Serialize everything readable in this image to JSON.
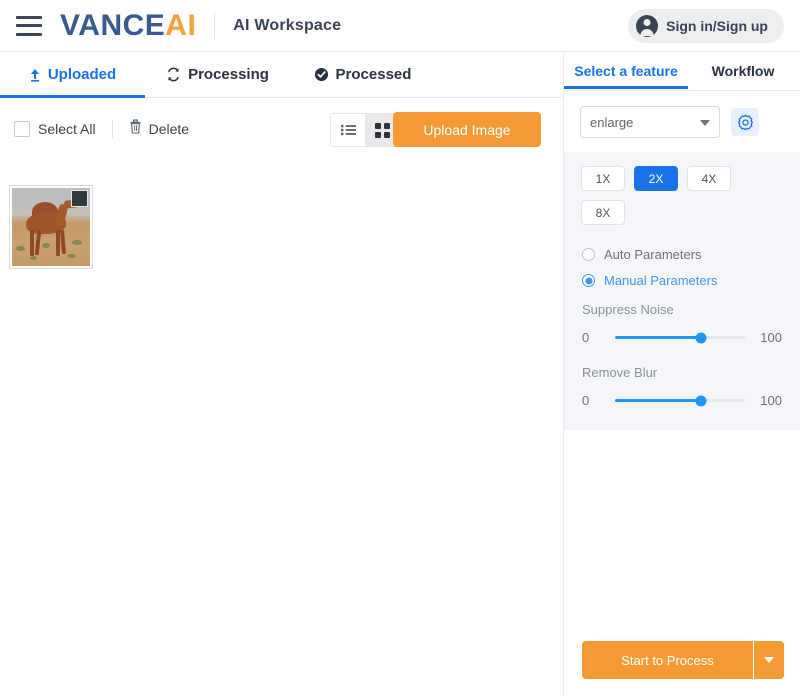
{
  "header": {
    "menu_icon": "hamburger-menu-icon",
    "logo_primary": "VANCE",
    "logo_accent": "AI",
    "workspace_title": "AI Workspace",
    "signin_label": "Sign in/Sign up",
    "signin_icon": "user-avatar-icon",
    "accent_orange": "#f5a13c",
    "logo_blue": "#3a5a8c"
  },
  "tabs": [
    {
      "label": "Uploaded",
      "icon": "upload-arrow-icon",
      "active": true
    },
    {
      "label": "Processing",
      "icon": "refresh-sync-icon",
      "active": false
    },
    {
      "label": "Processed",
      "icon": "check-circle-icon",
      "active": false
    }
  ],
  "toolbar": {
    "select_all_label": "Select All",
    "select_all_checked": false,
    "delete_label": "Delete",
    "delete_icon": "trash-icon",
    "list_view_icon": "list-view-icon",
    "grid_view_icon": "grid-view-icon",
    "active_view": "grid",
    "upload_label": "Upload Image",
    "upload_color": "#f59b35"
  },
  "files": [
    {
      "name": "camel-desert-thumbnail",
      "selected": true
    }
  ],
  "right_panel": {
    "tabs": [
      {
        "label": "Select a feature",
        "active": true
      },
      {
        "label": "Workflow",
        "active": false
      }
    ],
    "feature_select": {
      "value": "enlarge",
      "placeholder": "enlarge",
      "options": [
        "enlarge"
      ]
    },
    "settings_icon": "gear-icon",
    "scale_options": [
      {
        "label": "1X",
        "selected": false
      },
      {
        "label": "2X",
        "selected": true
      },
      {
        "label": "4X",
        "selected": false
      },
      {
        "label": "8X",
        "selected": false
      }
    ],
    "accent_blue": "#1a73e8",
    "parameter_mode": [
      {
        "label": "Auto Parameters",
        "selected": false
      },
      {
        "label": "Manual Parameters",
        "selected": true
      }
    ],
    "sliders": [
      {
        "label": "Suppress Noise",
        "min": "0",
        "max": "100",
        "percent": 66
      },
      {
        "label": "Remove Blur",
        "min": "0",
        "max": "100",
        "percent": 66
      }
    ],
    "start_label": "Start to Process",
    "start_dropdown_icon": "chevron-down-icon"
  }
}
